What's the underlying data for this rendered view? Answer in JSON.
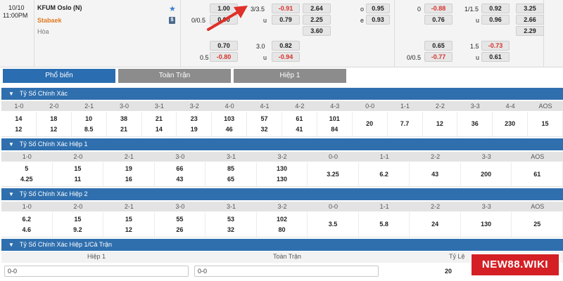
{
  "match": {
    "date": "10/10",
    "time": "11:00PM",
    "home": "KFUM Oslo (N)",
    "away": "Stabaek",
    "draw": "Hòa"
  },
  "odds": {
    "ft_hdp_home_line": "",
    "ft_hdp_home": "1.00",
    "ft_hdp_away_line": "0/0.5",
    "ft_hdp_away": "0.90",
    "ft_ou_line": "3/3.5",
    "ft_ou_over": "-0.91",
    "ft_ou_under_label": "u",
    "ft_ou_under": "0.79",
    "ft_1x2_1": "2.64",
    "ft_1x2_2": "2.25",
    "ft_1x2_x": "3.60",
    "ft_oe_o_label": "o",
    "ft_oe_o": "0.95",
    "ft_oe_e_label": "e",
    "ft_oe_e": "0.93",
    "h1_hdp_home_line": "0",
    "h1_hdp_home": "-0.88",
    "h1_hdp_away": "0.76",
    "h1_ou_line": "1/1.5",
    "h1_ou_over": "0.92",
    "h1_ou_under_label": "u",
    "h1_ou_under": "0.96",
    "h1_1x2_1": "3.25",
    "h1_1x2_2": "2.66",
    "h1_1x2_x": "2.29",
    "alt_ft_hdp_home": "0.70",
    "alt_ft_hdp_away_line": "0.5",
    "alt_ft_hdp_away": "-0.80",
    "alt_ft_ou_line": "3.0",
    "alt_ft_ou_over": "0.82",
    "alt_ft_ou_under_label": "u",
    "alt_ft_ou_under": "-0.94",
    "alt_h1_hdp_home": "0.65",
    "alt_h1_hdp_away_line": "0/0.5",
    "alt_h1_hdp_away": "-0.77",
    "alt_h1_ou_line": "1.5",
    "alt_h1_ou_over": "-0.73",
    "alt_h1_ou_under_label": "u",
    "alt_h1_ou_under": "0.61"
  },
  "tabs": [
    "Phổ biến",
    "Toàn Trận",
    "Hiệp 1"
  ],
  "sections": {
    "cs_ft": {
      "title": "Tỷ Số Chính Xác",
      "headers": [
        "1-0",
        "2-0",
        "2-1",
        "3-0",
        "3-1",
        "3-2",
        "4-0",
        "4-1",
        "4-2",
        "4-3",
        "0-0",
        "1-1",
        "2-2",
        "3-3",
        "4-4",
        "AOS"
      ],
      "top": [
        "14",
        "18",
        "10",
        "38",
        "21",
        "23",
        "103",
        "57",
        "61",
        "101",
        "20",
        "7.7",
        "12",
        "36",
        "230",
        "15"
      ],
      "bottom": [
        "12",
        "12",
        "8.5",
        "21",
        "14",
        "19",
        "46",
        "32",
        "41",
        "84",
        "",
        "",
        "",
        "",
        "",
        ""
      ]
    },
    "cs_h1": {
      "title": "Tỷ Số Chính Xác Hiệp 1",
      "headers": [
        "1-0",
        "2-0",
        "2-1",
        "3-0",
        "3-1",
        "3-2",
        "0-0",
        "1-1",
        "2-2",
        "3-3",
        "AOS"
      ],
      "top": [
        "5",
        "15",
        "19",
        "66",
        "85",
        "130",
        "3.25",
        "6.2",
        "43",
        "200",
        "61"
      ],
      "bottom": [
        "4.25",
        "11",
        "16",
        "43",
        "65",
        "130",
        "",
        "",
        "",
        "",
        ""
      ]
    },
    "cs_h2": {
      "title": "Tỷ Số Chính Xác Hiệp 2",
      "headers": [
        "1-0",
        "2-0",
        "2-1",
        "3-0",
        "3-1",
        "3-2",
        "0-0",
        "1-1",
        "2-2",
        "3-3",
        "AOS"
      ],
      "top": [
        "6.2",
        "15",
        "15",
        "55",
        "53",
        "102",
        "3.5",
        "5.8",
        "24",
        "130",
        "25"
      ],
      "bottom": [
        "4.6",
        "9.2",
        "12",
        "26",
        "32",
        "80",
        "",
        "",
        "",
        "",
        ""
      ]
    },
    "cs_h1_ft": {
      "title": "Tỷ Số Chính Xác Hiệp 1/Cả Trận",
      "col_h1": "Hiệp 1",
      "col_ft": "Toàn Trận",
      "col_odds": "Tỷ Lệ",
      "input_h1": "0-0",
      "input_ft": "0-0",
      "odds_value": "20"
    }
  },
  "brand": {
    "badge": "NEW88.WIKI",
    "badge_color": "#d42025",
    "accent": "#2f6fae"
  }
}
